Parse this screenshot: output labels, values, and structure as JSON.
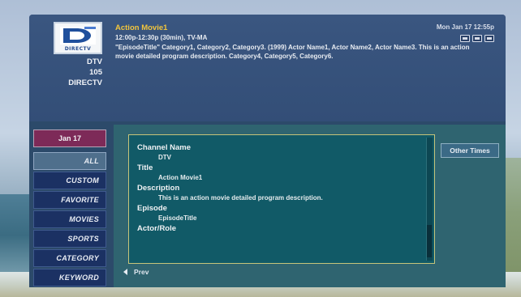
{
  "channel": {
    "logo_text": "DIRECTV",
    "name": "DTV",
    "number": "105",
    "network": "DIRECTV"
  },
  "program": {
    "title": "Action Movie1",
    "time_line": "12:00p-12:30p (30min), TV-MA",
    "description": "\"EpisodeTitle\" Category1, Category2, Category3. (1999) Actor Name1, Actor Name2, Actor Name3. This is an action movie detailed program description. Category4, Category5, Category6."
  },
  "clock": "Mon Jan 17 12:55p",
  "date_button": "Jan 17",
  "categories": [
    {
      "label": "ALL",
      "active": true
    },
    {
      "label": "CUSTOM",
      "active": false
    },
    {
      "label": "FAVORITE",
      "active": false
    },
    {
      "label": "MOVIES",
      "active": false
    },
    {
      "label": "SPORTS",
      "active": false
    },
    {
      "label": "CATEGORY",
      "active": false
    },
    {
      "label": "KEYWORD",
      "active": false
    }
  ],
  "details": [
    {
      "label": "Channel Name",
      "value": "DTV"
    },
    {
      "label": "Title",
      "value": "Action Movie1"
    },
    {
      "label": "Description",
      "value": "This is an action movie detailed program description."
    },
    {
      "label": "Episode",
      "value": "EpisodeTitle"
    },
    {
      "label": "Actor/Role",
      "value": ""
    }
  ],
  "other_times": "Other Times",
  "prev_label": "Prev",
  "colors": {
    "panel": "#324b72",
    "accent_title": "#f2c53c",
    "date_button": "#7d2a58",
    "info_box": "#115a67",
    "info_border": "#c6c47a"
  }
}
